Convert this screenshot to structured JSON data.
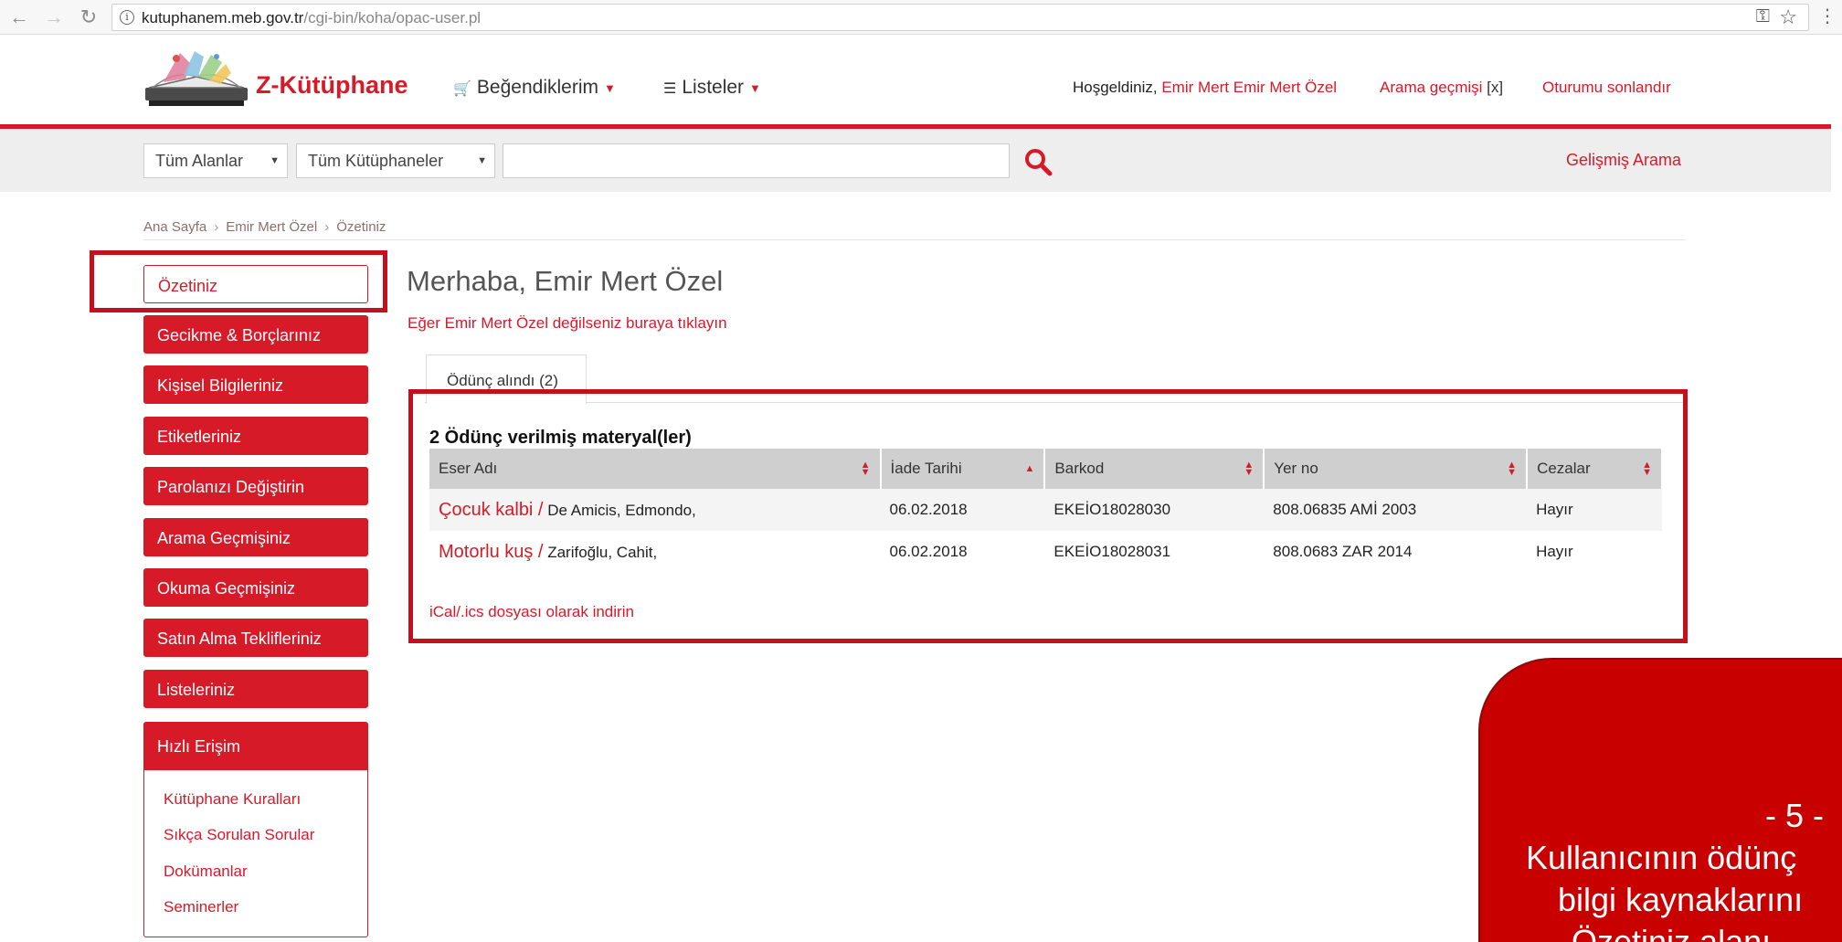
{
  "browser": {
    "url_domain": "kutuphanem.meb.gov.tr",
    "url_path": "/cgi-bin/koha/opac-user.pl"
  },
  "header": {
    "site_name": "Z-Kütüphane",
    "menu_likes": "Beğendiklerim",
    "menu_lists": "Listeler",
    "welcome_label": "Hoşgeldiniz,",
    "user_name": "Emir Mert Emir Mert Özel",
    "search_history": "Arama geçmişi",
    "search_history_clear": "[x]",
    "logout": "Oturumu sonlandır"
  },
  "search": {
    "field_select": "Tüm Alanlar",
    "library_select": "Tüm Kütüphaneler",
    "query": "",
    "advanced": "Gelişmiş Arama"
  },
  "breadcrumb": [
    "Ana Sayfa",
    "Emir Mert Özel",
    "Özetiniz"
  ],
  "sidebar": {
    "items": [
      "Özetiniz",
      "Gecikme & Borçlarınız",
      "Kişisel Bilgileriniz",
      "Etiketleriniz",
      "Parolanızı Değiştirin",
      "Arama Geçmişiniz",
      "Okuma Geçmişiniz",
      "Satın Alma Teklifleriniz",
      "Listeleriniz"
    ],
    "quick_title": "Hızlı Erişim",
    "quick_links": [
      "Kütüphane Kuralları",
      "Sıkça Sorulan Sorular",
      "Dokümanlar",
      "Seminerler"
    ]
  },
  "main": {
    "greeting": "Merhaba, Emir Mert Özel",
    "not_you": "Eğer Emir Mert Özel değilseniz buraya tıklayın",
    "tab_label": "Ödünç alındı (2)",
    "table_title": "2 Ödünç verilmiş materyal(ler)",
    "columns": [
      "Eser Adı",
      "İade Tarihi",
      "Barkod",
      "Yer no",
      "Cezalar"
    ],
    "rows": [
      {
        "title": "Çocuk kalbi /",
        "author": "De Amicis, Edmondo,",
        "due": "06.02.2018",
        "barcode": "EKEİO18028030",
        "callno": "808.06835 AMİ 2003",
        "fines": "Hayır"
      },
      {
        "title": "Motorlu kuş /",
        "author": "Zarifoğlu, Cahit,",
        "due": "06.02.2018",
        "barcode": "EKEİO18028031",
        "callno": "808.0683 ZAR 2014",
        "fines": "Hayır"
      }
    ],
    "ical": "iCal/.ics dosyası olarak indirin"
  },
  "callout": {
    "step": "- 5 -",
    "line1": "Kullanıcının ödünç",
    "line2": "bilgi kaynaklarını",
    "line3": "Özetiniz alanı"
  },
  "colors": {
    "brand_red": "#d61a28",
    "highlight_border": "#c4101c",
    "callout_red": "#c90000"
  }
}
